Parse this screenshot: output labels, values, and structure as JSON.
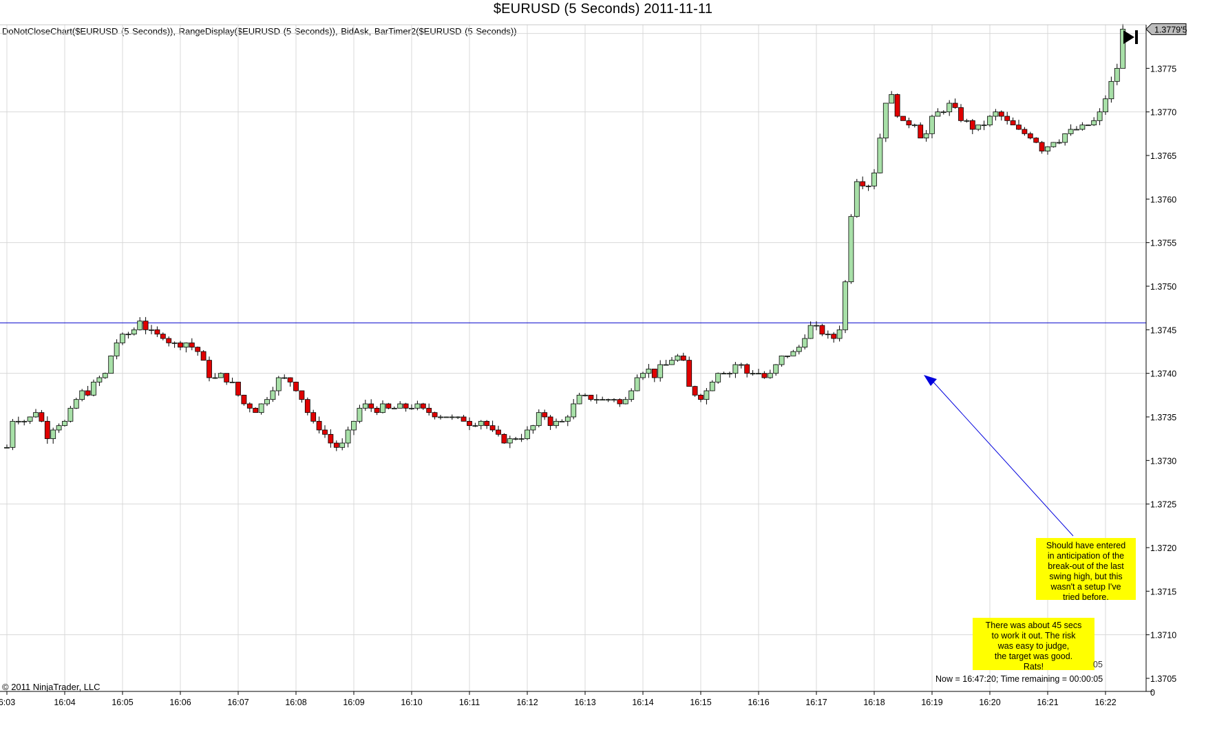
{
  "window": {
    "title": "$EURUSD (5 Seconds)  2011-11-11",
    "indicators": "DoNotCloseChart($EURUSD (5 Seconds)), RangeDisplay($EURUSD (5 Seconds)), BidAsk, BarTimer2($EURUSD (5 Seconds))",
    "copyright": "© 2011 NinjaTrader, LLC",
    "timer": "Now = 16:47:20; Time remaining = 00:00:05",
    "timer_ghost": "05",
    "zero_label": "0",
    "go_to_end_icon": "skip-to-end-icon"
  },
  "annotations": {
    "note1": [
      "Should have entered",
      "in anticipation of the",
      "break-out of the last",
      "swing high, but this",
      "wasn't a setup I've",
      "tried before."
    ],
    "note2": [
      "There was about 45 secs",
      "to work it out. The risk",
      "was easy to judge,",
      "the target was good.",
      "Rats!"
    ]
  },
  "colors": {
    "up_candle": "#a8e0a8",
    "down_candle": "#e00000",
    "grid": "#d8d8d8",
    "hline": "#0000cc",
    "note_bg": "#ffff00",
    "arrow": "#0000dd"
  },
  "chart_data": {
    "type": "candlestick",
    "title": "$EURUSD (5 Seconds)  2011-11-11",
    "xlabel": "",
    "ylabel": "",
    "ylim": [
      1.37035,
      1.378
    ],
    "y_ticks": [
      "1.3705",
      "1.3710",
      "1.3715",
      "1.3720",
      "1.3725",
      "1.3730",
      "1.3735",
      "1.3740",
      "1.3745",
      "1.3750",
      "1.3755",
      "1.3760",
      "1.3765",
      "1.3770",
      "1.3775"
    ],
    "y_tick_values": [
      1.3705,
      1.371,
      1.3715,
      1.372,
      1.3725,
      1.373,
      1.3735,
      1.374,
      1.3745,
      1.375,
      1.3755,
      1.376,
      1.3765,
      1.377,
      1.3775
    ],
    "x_ticks": [
      "6:03",
      "16:04",
      "16:05",
      "16:06",
      "16:07",
      "16:08",
      "16:09",
      "16:10",
      "16:11",
      "16:12",
      "16:13",
      "16:14",
      "16:15",
      "16:16",
      "16:17",
      "16:18",
      "16:19",
      "16:20",
      "16:21",
      "16:22"
    ],
    "x_tick_minutes": [
      963,
      964,
      965,
      966,
      967,
      968,
      969,
      970,
      971,
      972,
      973,
      974,
      975,
      976,
      977,
      978,
      979,
      980,
      981,
      982
    ],
    "x_range_minutes": [
      963.0,
      983.333
    ],
    "grid": true,
    "horizontal_line": 1.37458,
    "last_price_label": "1.3779'5",
    "last_price": 1.37795,
    "series": [
      {
        "name": "$EURUSD",
        "anchors": [
          [
            963.0,
            1.37315
          ],
          [
            963.08,
            1.37345
          ],
          [
            963.25,
            1.3735
          ],
          [
            963.35,
            1.3734
          ],
          [
            963.45,
            1.3736
          ],
          [
            963.6,
            1.37345
          ],
          [
            963.7,
            1.3733
          ],
          [
            963.85,
            1.3734
          ],
          [
            964.0,
            1.37345
          ],
          [
            964.15,
            1.3736
          ],
          [
            964.25,
            1.37375
          ],
          [
            964.4,
            1.3738
          ],
          [
            964.55,
            1.3739
          ],
          [
            964.7,
            1.374
          ],
          [
            964.85,
            1.3743
          ],
          [
            964.95,
            1.3744
          ],
          [
            965.05,
            1.37445
          ],
          [
            965.2,
            1.3745
          ],
          [
            965.3,
            1.3746
          ],
          [
            965.45,
            1.3745
          ],
          [
            965.6,
            1.37445
          ],
          [
            965.75,
            1.3744
          ],
          [
            965.9,
            1.37435
          ],
          [
            966.05,
            1.37435
          ],
          [
            966.2,
            1.3743
          ],
          [
            966.35,
            1.3742
          ],
          [
            966.45,
            1.374
          ],
          [
            966.6,
            1.37395
          ],
          [
            966.75,
            1.37395
          ],
          [
            966.9,
            1.37385
          ],
          [
            967.0,
            1.37375
          ],
          [
            967.15,
            1.3736
          ],
          [
            967.3,
            1.3736
          ],
          [
            967.45,
            1.37365
          ],
          [
            967.6,
            1.37385
          ],
          [
            967.75,
            1.37395
          ],
          [
            967.9,
            1.3739
          ],
          [
            968.05,
            1.3738
          ],
          [
            968.15,
            1.37365
          ],
          [
            968.25,
            1.37345
          ],
          [
            968.4,
            1.3734
          ],
          [
            968.55,
            1.37325
          ],
          [
            968.7,
            1.37315
          ],
          [
            968.8,
            1.3732
          ],
          [
            968.95,
            1.37335
          ],
          [
            969.05,
            1.37355
          ],
          [
            969.2,
            1.37365
          ],
          [
            969.35,
            1.37355
          ],
          [
            969.5,
            1.3736
          ],
          [
            969.65,
            1.3736
          ],
          [
            969.85,
            1.3736
          ],
          [
            970.0,
            1.3736
          ],
          [
            970.15,
            1.3736
          ],
          [
            970.3,
            1.37355
          ],
          [
            970.45,
            1.37355
          ],
          [
            970.6,
            1.3735
          ],
          [
            970.75,
            1.3735
          ],
          [
            970.9,
            1.37345
          ],
          [
            971.05,
            1.3734
          ],
          [
            971.2,
            1.37345
          ],
          [
            971.35,
            1.37335
          ],
          [
            971.5,
            1.37325
          ],
          [
            971.65,
            1.3732
          ],
          [
            971.8,
            1.37325
          ],
          [
            971.95,
            1.3733
          ],
          [
            972.1,
            1.3734
          ],
          [
            972.25,
            1.37355
          ],
          [
            972.35,
            1.3735
          ],
          [
            972.45,
            1.3734
          ],
          [
            972.6,
            1.37345
          ],
          [
            972.75,
            1.3736
          ],
          [
            972.9,
            1.3737
          ],
          [
            973.05,
            1.37375
          ],
          [
            973.2,
            1.3737
          ],
          [
            973.35,
            1.3737
          ],
          [
            973.45,
            1.37375
          ],
          [
            973.6,
            1.37365
          ],
          [
            973.75,
            1.3737
          ],
          [
            973.85,
            1.37395
          ],
          [
            973.95,
            1.374
          ],
          [
            974.05,
            1.37405
          ],
          [
            974.2,
            1.374
          ],
          [
            974.35,
            1.3741
          ],
          [
            974.5,
            1.37415
          ],
          [
            974.6,
            1.3742
          ],
          [
            974.7,
            1.3741
          ],
          [
            974.8,
            1.37385
          ],
          [
            974.95,
            1.3737
          ],
          [
            975.1,
            1.3738
          ],
          [
            975.25,
            1.374
          ],
          [
            975.35,
            1.37405
          ],
          [
            975.5,
            1.374
          ],
          [
            975.65,
            1.37415
          ],
          [
            975.75,
            1.37405
          ],
          [
            975.85,
            1.374
          ],
          [
            976.0,
            1.374
          ],
          [
            976.15,
            1.37395
          ],
          [
            976.3,
            1.3741
          ],
          [
            976.45,
            1.37425
          ],
          [
            976.55,
            1.3742
          ],
          [
            976.7,
            1.3743
          ],
          [
            976.8,
            1.37445
          ],
          [
            976.9,
            1.37455
          ],
          [
            977.05,
            1.3745
          ],
          [
            977.15,
            1.37445
          ],
          [
            977.3,
            1.3744
          ],
          [
            977.45,
            1.3746
          ],
          [
            977.55,
            1.3755
          ],
          [
            977.65,
            1.3762
          ],
          [
            977.75,
            1.37625
          ],
          [
            977.85,
            1.37615
          ],
          [
            977.95,
            1.3762
          ],
          [
            978.05,
            1.3764
          ],
          [
            978.15,
            1.377
          ],
          [
            978.25,
            1.37725
          ],
          [
            978.35,
            1.3771
          ],
          [
            978.45,
            1.3769
          ],
          [
            978.55,
            1.3768
          ],
          [
            978.65,
            1.37695
          ],
          [
            978.75,
            1.3768
          ],
          [
            978.85,
            1.37665
          ],
          [
            979.0,
            1.3769
          ],
          [
            979.15,
            1.377
          ],
          [
            979.3,
            1.3771
          ],
          [
            979.45,
            1.377
          ],
          [
            979.55,
            1.3769
          ],
          [
            979.7,
            1.3768
          ],
          [
            979.85,
            1.37685
          ],
          [
            980.0,
            1.37695
          ],
          [
            980.15,
            1.377
          ],
          [
            980.3,
            1.3769
          ],
          [
            980.45,
            1.3768
          ],
          [
            980.6,
            1.37675
          ],
          [
            980.75,
            1.3767
          ],
          [
            980.9,
            1.3766
          ],
          [
            981.05,
            1.37665
          ],
          [
            981.2,
            1.3767
          ],
          [
            981.35,
            1.37675
          ],
          [
            981.5,
            1.3768
          ],
          [
            981.65,
            1.37685
          ],
          [
            981.8,
            1.3769
          ],
          [
            981.9,
            1.377
          ],
          [
            982.0,
            1.37715
          ],
          [
            982.1,
            1.37735
          ],
          [
            982.2,
            1.3775
          ],
          [
            982.3,
            1.37765
          ],
          [
            982.38,
            1.37795
          ]
        ]
      }
    ]
  }
}
